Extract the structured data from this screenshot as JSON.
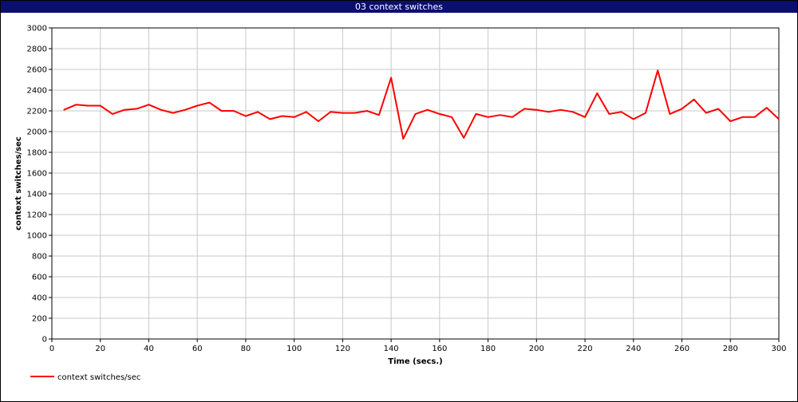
{
  "window": {
    "title": "03 context switches"
  },
  "colors": {
    "title_bar": "#0a0f6e",
    "series": "#ff0000",
    "grid": "#c8c8c8"
  },
  "chart_data": {
    "type": "line",
    "title": "03 context switches",
    "xlabel": "Time (secs.)",
    "ylabel": "context switches/sec",
    "xlim": [
      0,
      300
    ],
    "ylim": [
      0,
      3000
    ],
    "xticks": [
      0,
      20,
      40,
      60,
      80,
      100,
      120,
      140,
      160,
      180,
      200,
      220,
      240,
      260,
      280,
      300
    ],
    "yticks": [
      0,
      200,
      400,
      600,
      800,
      1000,
      1200,
      1400,
      1600,
      1800,
      2000,
      2200,
      2400,
      2600,
      2800,
      3000
    ],
    "grid": true,
    "legend_position": "bottom-left",
    "series": [
      {
        "name": "context switches/sec",
        "color": "#ff0000",
        "x": [
          5,
          10,
          15,
          20,
          25,
          30,
          35,
          40,
          45,
          50,
          55,
          60,
          65,
          70,
          75,
          80,
          85,
          90,
          95,
          100,
          105,
          110,
          115,
          120,
          125,
          130,
          135,
          140,
          145,
          150,
          155,
          160,
          165,
          170,
          175,
          180,
          185,
          190,
          195,
          200,
          205,
          210,
          215,
          220,
          225,
          230,
          235,
          240,
          245,
          250,
          255,
          260,
          265,
          270,
          275,
          280,
          285,
          290,
          295,
          300
        ],
        "y": [
          2210,
          2260,
          2250,
          2250,
          2170,
          2210,
          2220,
          2260,
          2210,
          2180,
          2210,
          2250,
          2280,
          2200,
          2200,
          2150,
          2190,
          2120,
          2150,
          2140,
          2190,
          2100,
          2190,
          2180,
          2180,
          2200,
          2160,
          2520,
          1930,
          2170,
          2210,
          2170,
          2140,
          1940,
          2170,
          2140,
          2160,
          2140,
          2220,
          2210,
          2190,
          2210,
          2190,
          2140,
          2370,
          2170,
          2190,
          2120,
          2180,
          2590,
          2170,
          2220,
          2310,
          2180,
          2220,
          2100,
          2140,
          2140,
          2230,
          2120
        ]
      }
    ]
  }
}
